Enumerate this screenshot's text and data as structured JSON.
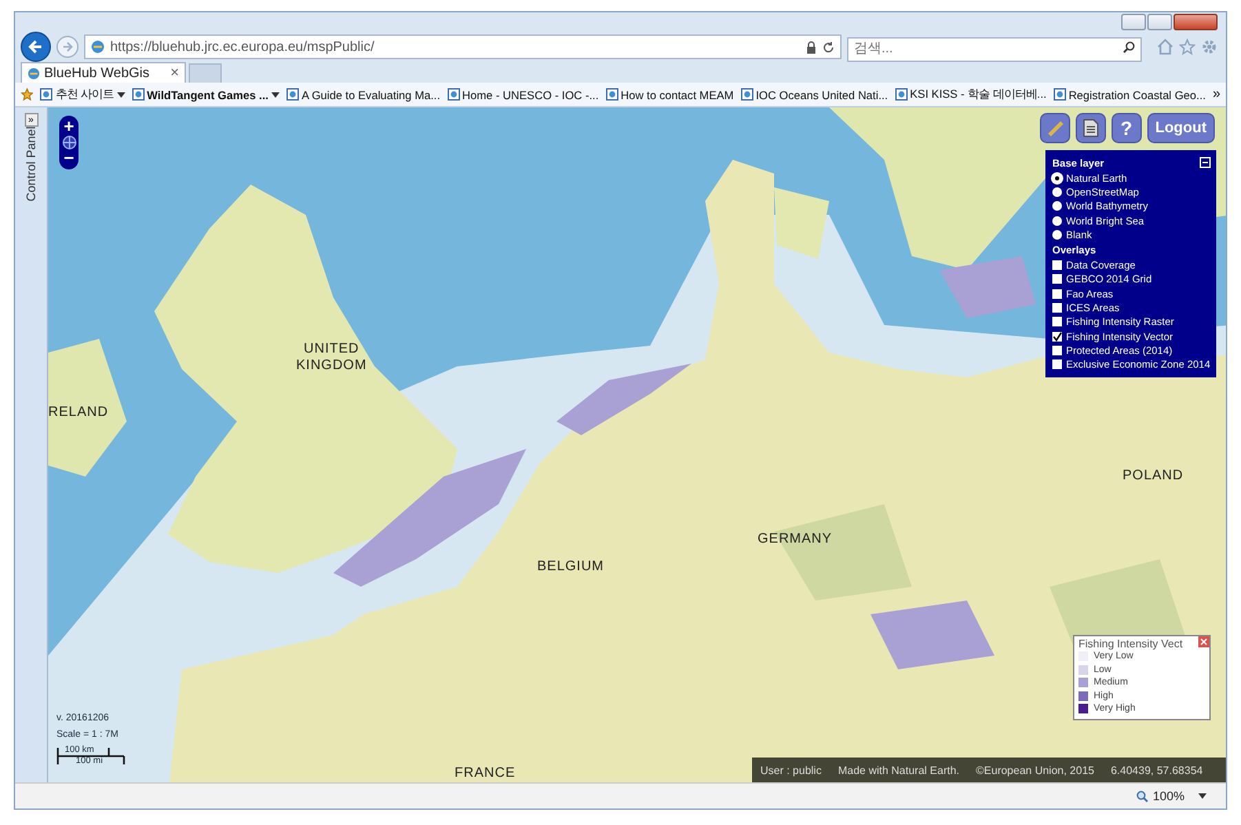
{
  "browser": {
    "address": "https://bluehub.jrc.ec.europa.eu/mspPublic/",
    "search_placeholder": "검색...",
    "tabs": [
      {
        "title": "BlueHub WebGis",
        "close": "×",
        "selected": true
      }
    ],
    "favorites": [
      {
        "label": "추천 사이트",
        "dropdown": true,
        "bold": false
      },
      {
        "label": "WildTangent Games ...",
        "dropdown": true,
        "bold": true
      },
      {
        "label": "A Guide to Evaluating Ma...",
        "dropdown": false,
        "bold": false
      },
      {
        "label": "Home - UNESCO - IOC -...",
        "dropdown": false,
        "bold": false
      },
      {
        "label": "How to contact MEAM",
        "dropdown": false,
        "bold": false
      },
      {
        "label": "IOC Oceans  United Nati...",
        "dropdown": false,
        "bold": false
      },
      {
        "label": "KSI KISS - 학술 데이터베...",
        "dropdown": false,
        "bold": false
      },
      {
        "label": "Registration  Coastal Geo...",
        "dropdown": false,
        "bold": false
      }
    ],
    "more": "»",
    "zoom": "100%"
  },
  "control_panel": {
    "label": "Control Panel",
    "toggle": "»"
  },
  "zoom_controls": {
    "plus": "+",
    "minus": "−"
  },
  "toolbar": {
    "help": "?",
    "logout": "Logout"
  },
  "layers": {
    "base_title": "Base layer",
    "base_layers": [
      {
        "label": "Natural Earth",
        "selected": true
      },
      {
        "label": "OpenStreetMap",
        "selected": false
      },
      {
        "label": "World Bathymetry",
        "selected": false
      },
      {
        "label": "World Bright Sea",
        "selected": false
      },
      {
        "label": "Blank",
        "selected": false
      }
    ],
    "overlays_title": "Overlays",
    "overlays": [
      {
        "label": "Data Coverage",
        "checked": false
      },
      {
        "label": "GEBCO 2014 Grid",
        "checked": false
      },
      {
        "label": "Fao Areas",
        "checked": false
      },
      {
        "label": "ICES Areas",
        "checked": false
      },
      {
        "label": "Fishing Intensity Raster",
        "checked": false
      },
      {
        "label": "Fishing Intensity Vector",
        "checked": true
      },
      {
        "label": "Protected Areas (2014)",
        "checked": false
      },
      {
        "label": "Exclusive Economic Zone 2014",
        "checked": false
      }
    ]
  },
  "map_labels": [
    {
      "text": "UNITED\nKINGDOM"
    },
    {
      "text": "RELAND"
    },
    {
      "text": "POLAND"
    },
    {
      "text": "GERMANY"
    },
    {
      "text": "BELGIUM"
    },
    {
      "text": "FRANCE"
    }
  ],
  "legend": {
    "title": "Fishing Intensity Vect",
    "items": [
      {
        "label": "Very Low",
        "color": "#f0eef8"
      },
      {
        "label": "Low",
        "color": "#d8d4ec"
      },
      {
        "label": "Medium",
        "color": "#a9a0d4"
      },
      {
        "label": "High",
        "color": "#7c6cb8"
      },
      {
        "label": "Very High",
        "color": "#4a1e8c"
      }
    ]
  },
  "info": {
    "version": "v. 20161206",
    "scale": "Scale = 1 : 7M",
    "scale_km": "100 km",
    "scale_mi": "100 mi"
  },
  "attribution": {
    "user": "User : public",
    "credit": "Made with Natural Earth.",
    "copyright": "©European Union, 2015",
    "coords": "6.40439, 57.68354"
  }
}
